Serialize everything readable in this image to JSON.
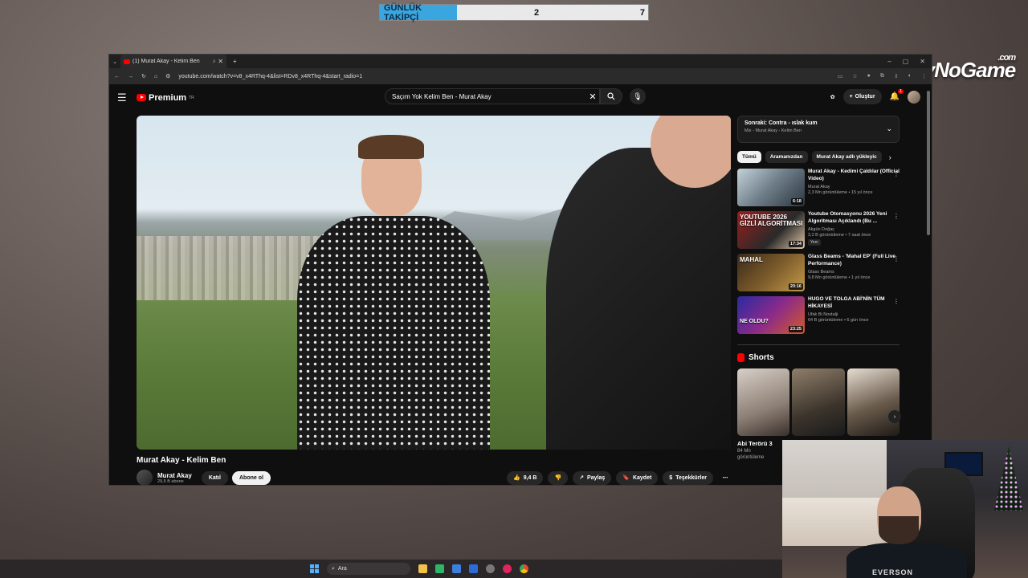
{
  "overlay": {
    "follower_label": "GÜNLÜK TAKİPÇİ",
    "follower_current": "2",
    "follower_goal": "7",
    "brand_text": "ByNoGame",
    "brand_suffix": ".com"
  },
  "browser": {
    "tab_title": "(1) Murat Akay - Kelim Ben",
    "url": "youtube.com/watch?v=v8_x4RThq-4&list=RDv8_x4RThq-4&start_radio=1"
  },
  "youtube": {
    "logo_text": "Premium",
    "logo_sup": "TR",
    "search_value": "Saçım Yok Kelim Ben - Murat Akay",
    "create_label": "Oluştur",
    "notification_count": "1",
    "video_title": "Murat Akay - Kelim Ben",
    "channel_name": "Murat Akay",
    "channel_subs": "29,5 B abone",
    "join_label": "Katıl",
    "subscribe_label": "Abone ol",
    "like_count": "9,4 B",
    "share_label": "Paylaş",
    "save_label": "Kaydet",
    "thanks_label": "Teşekkürler",
    "up_next": {
      "title": "Sonraki: Contra - ıslak kum",
      "subtitle": "Mix - Murat Akay - Kelim Ben"
    },
    "chips": [
      "Tümü",
      "Aramanızdan",
      "Murat Akay adlı yükleyic"
    ],
    "recommendations": [
      {
        "title": "Murat Akay - Kedimi Çaldılar (Official Video)",
        "channel": "Murat Akay",
        "stats": "2,3 Mn görüntüleme • 15 yıl önce",
        "duration": "6:18",
        "caption": "",
        "badge": ""
      },
      {
        "title": "Youtube Otomasyonu 2026 Yeni Algoritması Açıklandı (Bu ...",
        "channel": "Akgün Doğaç",
        "stats": "3,2 B görüntüleme • 7 saat önce",
        "duration": "17:34",
        "caption": "YOUTUBE 2026 GİZLİ ALGORİTMASI",
        "badge": "Yeni"
      },
      {
        "title": "Glass Beams - 'Mahal EP' (Full Live Performance)",
        "channel": "Glass Beams",
        "stats": "9,8 Mn görüntüleme • 1 yıl önce",
        "duration": "20:16",
        "caption": "MAHAL",
        "badge": ""
      },
      {
        "title": "HUGO VE TOLGA ABİ'NİN TÜM HİKAYESİ",
        "channel": "Ufak Bi Nostalji",
        "stats": "64 B görüntüleme • 6 gün önce",
        "duration": "23:25",
        "caption": "NE OLDU?",
        "badge": ""
      }
    ],
    "shorts_heading": "Shorts",
    "short_title": "Abi Terörü 3",
    "short_views": "84 Mn görüntüleme"
  },
  "webcam": {
    "shirt_text": "EVERSON"
  },
  "taskbar": {
    "search_placeholder": "Ara"
  },
  "colors": {
    "youtube_red": "#ff0000",
    "follower_accent": "#3aa6df"
  }
}
